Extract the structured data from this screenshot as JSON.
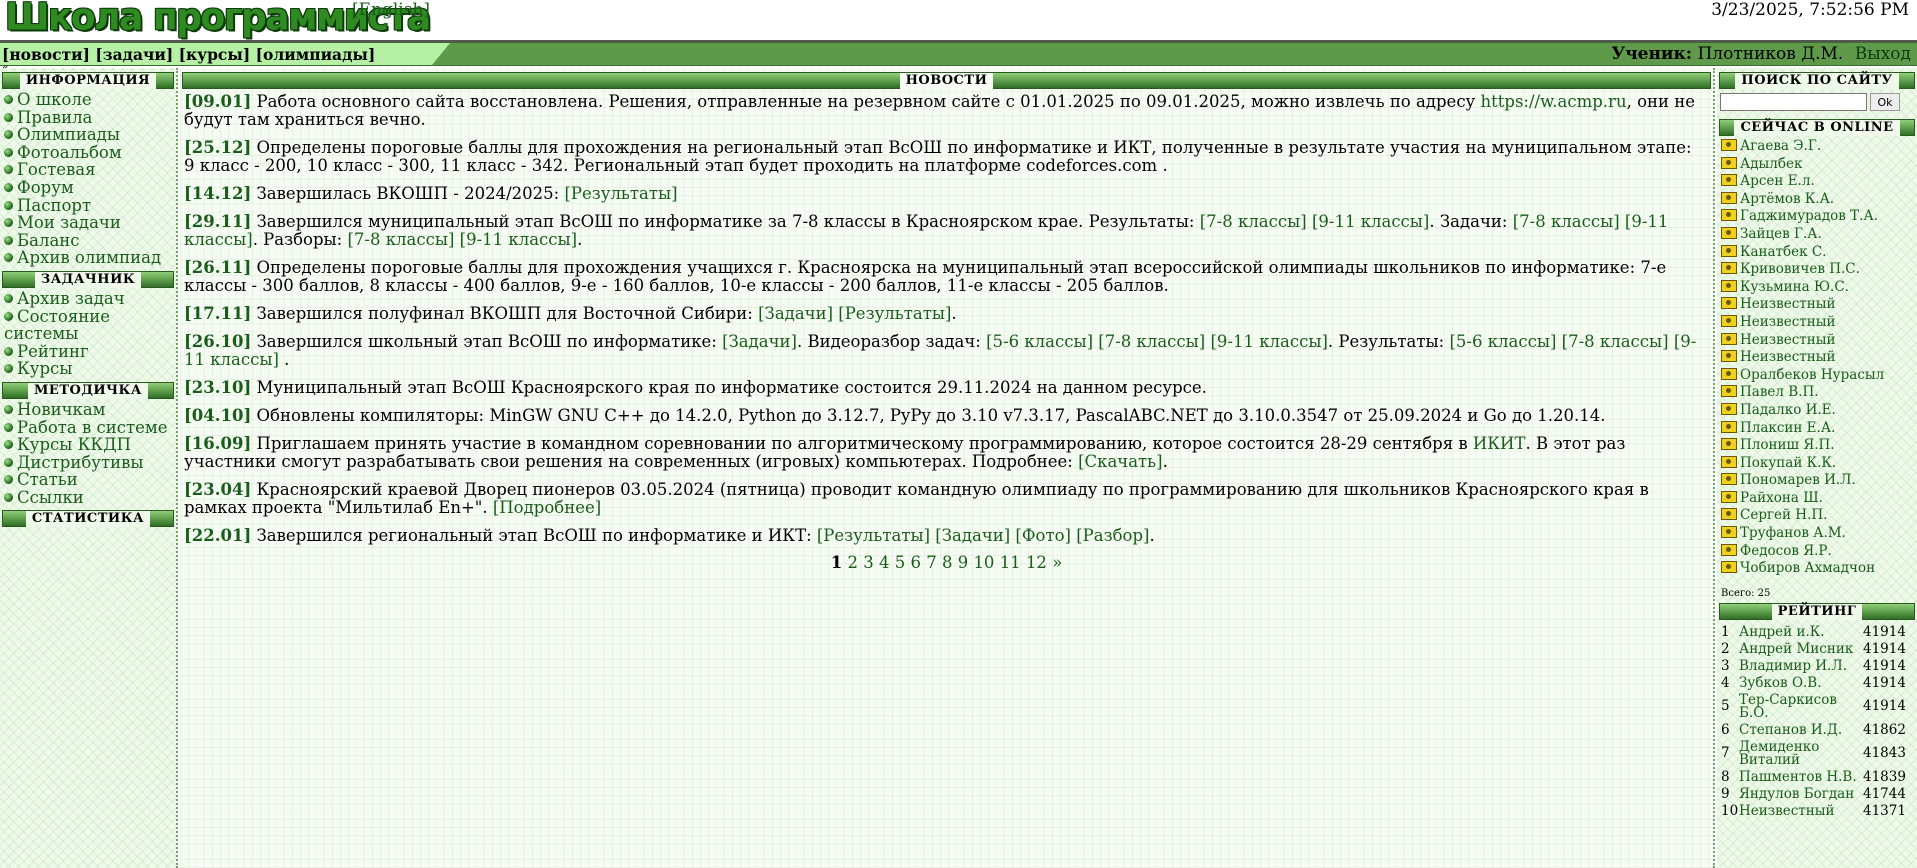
{
  "header": {
    "logo": "Школа программиста",
    "lang": "[English]",
    "datetime": "3/23/2025, 7:52:56 PM"
  },
  "nav": {
    "links": [
      "[новости]",
      "[задачи]",
      "[курсы]",
      "[олимпиады]"
    ],
    "user_label": "Ученик:",
    "user_name": "Плотников Д.М.",
    "logout": "Выход",
    "collapse": "«"
  },
  "left": {
    "info_title": "ИНФОРМАЦИЯ",
    "info_items": [
      "О школе",
      "Правила",
      "Олимпиады",
      "Фотоальбом",
      "Гостевая",
      "Форум",
      "Паспорт",
      "Мои задачи",
      "Баланс",
      "Архив олимпиад"
    ],
    "tasks_title": "ЗАДАЧНИК",
    "tasks_items": [
      "Архив задач",
      "Состояние системы",
      "Рейтинг",
      "Курсы"
    ],
    "method_title": "МЕТОДИЧКА",
    "method_items": [
      "Новичкам",
      "Работа в системе",
      "Курсы ККДП",
      "Дистрибутивы",
      "Статьи",
      "Ссылки"
    ],
    "stats_title": "СТАТИСТИКА"
  },
  "main": {
    "title": "НОВОСТИ",
    "news": [
      {
        "date": "[09.01]",
        "parts": [
          {
            "t": " Работа основного сайта восстановлена. Решения, отправленные на резервном сайте с 01.01.2025 по 09.01.2025, можно извлечь по адресу "
          },
          {
            "l": "https://w.acmp.ru"
          },
          {
            "t": ", они не будут там храниться вечно."
          }
        ]
      },
      {
        "date": "[25.12]",
        "parts": [
          {
            "t": " Определены пороговые баллы для прохождения на региональный этап ВсОШ по информатике и ИКТ, полученные в результате участия на муниципальном этапе: 9 класс - 200, 10 класс - 300, 11 класс - 342. Региональный этап будет проходить на платформе codeforces.com ."
          }
        ]
      },
      {
        "date": "[14.12]",
        "parts": [
          {
            "t": " Завершилась ВКОШП - 2024/2025: "
          },
          {
            "l": "[Результаты]"
          }
        ]
      },
      {
        "date": "[29.11]",
        "parts": [
          {
            "t": " Завершился муниципальный этап ВсОШ по информатике за 7-8 классы в Красноярском крае. Результаты: "
          },
          {
            "l": "[7-8 классы]"
          },
          {
            "t": " "
          },
          {
            "l": "[9-11 классы]"
          },
          {
            "t": ". Задачи: "
          },
          {
            "l": "[7-8 классы]"
          },
          {
            "t": " "
          },
          {
            "l": "[9-11 классы]"
          },
          {
            "t": ". Разборы: "
          },
          {
            "l": "[7-8 классы]"
          },
          {
            "t": " "
          },
          {
            "l": "[9-11 классы]"
          },
          {
            "t": "."
          }
        ]
      },
      {
        "date": "[26.11]",
        "parts": [
          {
            "t": " Определены пороговые баллы для прохождения учащихся г. Красноярска на муниципальный этап всероссийской олимпиады школьников по информатике: 7-е классы - 300 баллов, 8 классы - 400 баллов, 9-е - 160 баллов, 10-е классы - 200 баллов, 11-е классы - 205 баллов."
          }
        ]
      },
      {
        "date": "[17.11]",
        "parts": [
          {
            "t": " Завершился полуфинал ВКОШП для Восточной Сибири: "
          },
          {
            "l": "[Задачи]"
          },
          {
            "t": " "
          },
          {
            "l": "[Результаты]"
          },
          {
            "t": "."
          }
        ]
      },
      {
        "date": "[26.10]",
        "parts": [
          {
            "t": " Завершился школьный этап ВсОШ по информатике: "
          },
          {
            "l": "[Задачи]"
          },
          {
            "t": ". Видеоразбор задач: "
          },
          {
            "l": "[5-6 классы]"
          },
          {
            "t": " "
          },
          {
            "l": "[7-8 классы]"
          },
          {
            "t": " "
          },
          {
            "l": "[9-11 классы]"
          },
          {
            "t": ". Результаты: "
          },
          {
            "l": "[5-6 классы]"
          },
          {
            "t": " "
          },
          {
            "l": "[7-8 классы]"
          },
          {
            "t": " "
          },
          {
            "l": "[9-11 классы]"
          },
          {
            "t": " ."
          }
        ]
      },
      {
        "date": "[23.10]",
        "parts": [
          {
            "t": " Муниципальный этап ВсОШ Красноярского края по информатике состоится 29.11.2024 на данном ресурсе."
          }
        ]
      },
      {
        "date": "[04.10]",
        "parts": [
          {
            "t": " Обновлены компиляторы: MinGW GNU C++ до 14.2.0, Python до 3.12.7, PyPy до 3.10 v7.3.17, PascalABC.NET до 3.10.0.3547 от 25.09.2024 и Go до 1.20.14."
          }
        ]
      },
      {
        "date": "[16.09]",
        "parts": [
          {
            "t": " Приглашаем принять участие в командном соревновании по алгоритмическому программированию, которое состоится 28-29 сентября в "
          },
          {
            "l": "ИКИТ"
          },
          {
            "t": ". В этот раз участники смогут разрабатывать свои решения на современных (игровых) компьютерах. Подробнее: "
          },
          {
            "l": "[Скачать]"
          },
          {
            "t": "."
          }
        ]
      },
      {
        "date": "[23.04]",
        "parts": [
          {
            "t": " Красноярский краевой Дворец пионеров 03.05.2024 (пятница) проводит командную олимпиаду по программированию для школьников Красноярского края в рамках проекта \"Мильтилаб Еn+\". "
          },
          {
            "l": "[Подробнее]"
          }
        ]
      },
      {
        "date": "[22.01]",
        "parts": [
          {
            "t": " Завершился региональный этап ВсОШ по информатике и ИКТ: "
          },
          {
            "l": "[Результаты]"
          },
          {
            "t": " "
          },
          {
            "l": "[Задачи]"
          },
          {
            "t": " "
          },
          {
            "l": "[Фото]"
          },
          {
            "t": " "
          },
          {
            "l": "[Разбор]"
          },
          {
            "t": "."
          }
        ]
      }
    ],
    "pager": {
      "current": "1",
      "pages": [
        "2",
        "3",
        "4",
        "5",
        "6",
        "7",
        "8",
        "9",
        "10",
        "11",
        "12"
      ],
      "next": "»"
    }
  },
  "right": {
    "search_title": "ПОИСК ПО САЙТУ",
    "search_value": "",
    "search_button": "Ok",
    "online_title": "СЕЙЧАС В ONLINE",
    "online": [
      "Агаева Э.Г.",
      "Адылбек",
      "Арсен Е.л.",
      "Артёмов К.А.",
      "Гаджимурадов Т.А.",
      "Зайцев Г.А.",
      "Канатбек С.",
      "Кривовичев П.С.",
      "Кузьмина Ю.С.",
      "Неизвестный",
      "Неизвестный",
      "Неизвестный",
      "Неизвестный",
      "Оралбеков Нурасыл",
      "Павел В.П.",
      "Падалко И.Е.",
      "Плаксин Е.А.",
      "Плониш Я.П.",
      "Покупай К.К.",
      "Пономарев И.Л.",
      "Райхона Ш.",
      "Сергей Н.П.",
      "Труфанов А.М.",
      "Федосов Я.Р.",
      "Чобиров Ахмадчон"
    ],
    "total": "Всего: 25",
    "rating_title": "РЕЙТИНГ",
    "rating": [
      {
        "n": "1",
        "name": "Андрей и.К.",
        "score": "41914"
      },
      {
        "n": "2",
        "name": "Андрей Мисник",
        "score": "41914"
      },
      {
        "n": "3",
        "name": "Владимир И.Л.",
        "score": "41914"
      },
      {
        "n": "4",
        "name": "Зубков О.В.",
        "score": "41914"
      },
      {
        "n": "5",
        "name": "Тер-Саркисов Б.О.",
        "score": "41914"
      },
      {
        "n": "6",
        "name": "Степанов И.Д.",
        "score": "41862"
      },
      {
        "n": "7",
        "name": "Демиденко Виталий",
        "score": "41843"
      },
      {
        "n": "8",
        "name": "Пашментов Н.В.",
        "score": "41839"
      },
      {
        "n": "9",
        "name": "Яндулов Богдан",
        "score": "41744"
      },
      {
        "n": "10",
        "name": "Неизвестный",
        "score": "41371"
      }
    ]
  }
}
